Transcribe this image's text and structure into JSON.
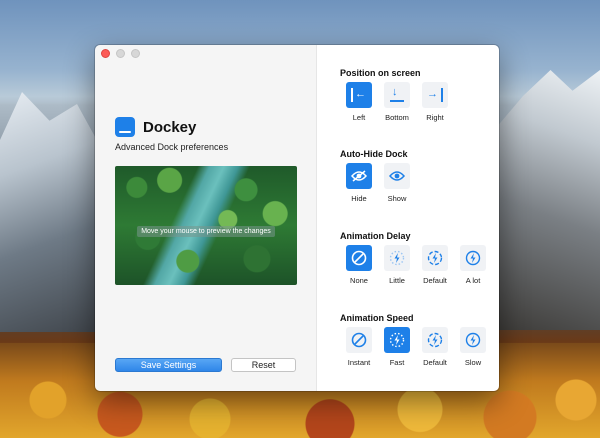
{
  "app": {
    "name": "Dockey",
    "subtitle": "Advanced Dock preferences"
  },
  "preview": {
    "hint": "Move your mouse to preview the changes"
  },
  "buttons": {
    "save": "Save Settings",
    "reset": "Reset"
  },
  "position": {
    "title": "Position on screen",
    "options": [
      {
        "label": "Left",
        "icon": "dock-left-icon",
        "selected": true
      },
      {
        "label": "Bottom",
        "icon": "dock-bottom-icon",
        "selected": false
      },
      {
        "label": "Right",
        "icon": "dock-right-icon",
        "selected": false
      }
    ]
  },
  "autohide": {
    "title": "Auto-Hide Dock",
    "options": [
      {
        "label": "Hide",
        "icon": "eye-hidden-icon",
        "selected": true
      },
      {
        "label": "Show",
        "icon": "eye-icon",
        "selected": false
      }
    ]
  },
  "delay": {
    "title": "Animation Delay",
    "options": [
      {
        "label": "None",
        "icon": "no-delay-icon",
        "selected": true
      },
      {
        "label": "Little",
        "icon": "little-delay-icon",
        "selected": false
      },
      {
        "label": "Default",
        "icon": "default-delay-icon",
        "selected": false
      },
      {
        "label": "A lot",
        "icon": "lot-delay-icon",
        "selected": false
      }
    ]
  },
  "speed": {
    "title": "Animation Speed",
    "options": [
      {
        "label": "Instant",
        "icon": "instant-speed-icon",
        "selected": false
      },
      {
        "label": "Fast",
        "icon": "fast-speed-icon",
        "selected": true
      },
      {
        "label": "Default",
        "icon": "default-speed-icon",
        "selected": false
      },
      {
        "label": "Slow",
        "icon": "slow-speed-icon",
        "selected": false
      }
    ]
  },
  "colors": {
    "accent": "#1e80e8",
    "option_bg": "#f0f2f5",
    "close": "#fc5b57"
  }
}
